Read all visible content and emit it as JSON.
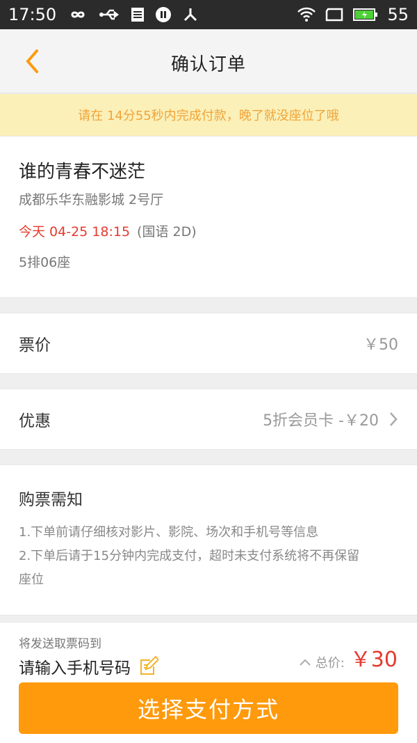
{
  "status_bar": {
    "time": "17:50",
    "battery": "55"
  },
  "header": {
    "title": "确认订单"
  },
  "notice": "请在 14分55秒内完成付款，晚了就没座位了哦",
  "movie": {
    "name": "谁的青春不迷茫",
    "cinema": "成都乐华东融影城 2号厅",
    "time_red": "今天 04-25 18:15",
    "format": "(国语 2D)",
    "seat": "5排06座"
  },
  "price": {
    "label": "票价",
    "value": "￥50"
  },
  "discount": {
    "label": "优惠",
    "value": "5折会员卡  -￥20"
  },
  "notes": {
    "title": "购票需知",
    "lines": [
      "1.下单前请仔细核对影片、影院、场次和手机号等信息",
      "2.下单后请于15分钟内完成支付，超时未支付系统将不再保留",
      "座位"
    ]
  },
  "bottom": {
    "send_text": "将发送取票码到",
    "phone_placeholder": "请输入手机号码",
    "total_label": "总价:",
    "total_amount": "￥30",
    "pay_button": "选择支付方式"
  },
  "colors": {
    "accent": "#ff9a0c",
    "notice_bg": "#fbf0b8",
    "notice_text": "#f0a43a",
    "price_red": "#e53a2e"
  }
}
